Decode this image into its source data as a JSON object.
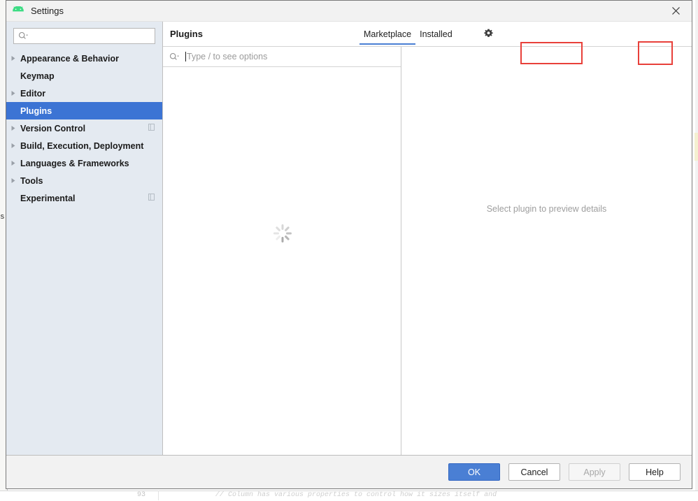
{
  "window": {
    "title": "Settings",
    "app_icon": "android-robot-icon",
    "close_icon": "close-icon"
  },
  "sidebar": {
    "search": {
      "value": "",
      "placeholder": "",
      "icon": "search-icon"
    },
    "items": [
      {
        "label": "Appearance & Behavior",
        "expandable": true,
        "selected": false,
        "trailing_icon": ""
      },
      {
        "label": "Keymap",
        "expandable": false,
        "selected": false,
        "trailing_icon": ""
      },
      {
        "label": "Editor",
        "expandable": true,
        "selected": false,
        "trailing_icon": ""
      },
      {
        "label": "Plugins",
        "expandable": false,
        "selected": true,
        "trailing_icon": ""
      },
      {
        "label": "Version Control",
        "expandable": true,
        "selected": false,
        "trailing_icon": "project-scope-icon"
      },
      {
        "label": "Build, Execution, Deployment",
        "expandable": true,
        "selected": false,
        "trailing_icon": ""
      },
      {
        "label": "Languages & Frameworks",
        "expandable": true,
        "selected": false,
        "trailing_icon": ""
      },
      {
        "label": "Tools",
        "expandable": true,
        "selected": false,
        "trailing_icon": ""
      },
      {
        "label": "Experimental",
        "expandable": false,
        "selected": false,
        "trailing_icon": "project-scope-icon"
      }
    ]
  },
  "main": {
    "title": "Plugins",
    "tabs": [
      {
        "label": "Marketplace",
        "active": true
      },
      {
        "label": "Installed",
        "active": false
      }
    ],
    "settings_button_icon": "gear-icon",
    "plugin_search": {
      "value": "",
      "placeholder": "Type / to see options",
      "icon": "search-icon"
    },
    "list_state": "loading",
    "preview_placeholder": "Select plugin to preview details"
  },
  "footer": {
    "buttons": [
      {
        "label": "OK",
        "style": "primary"
      },
      {
        "label": "Cancel",
        "style": "default"
      },
      {
        "label": "Apply",
        "style": "disabled"
      },
      {
        "label": "Help",
        "style": "default"
      }
    ]
  },
  "annotations": {
    "color": "#e8403a",
    "boxes": [
      "marketplace-tab",
      "plugins-settings-gear"
    ]
  },
  "background": {
    "edge_glyph": "s",
    "gutter_number": "93",
    "code_line": "// Column has various properties to control how it sizes itself and"
  }
}
